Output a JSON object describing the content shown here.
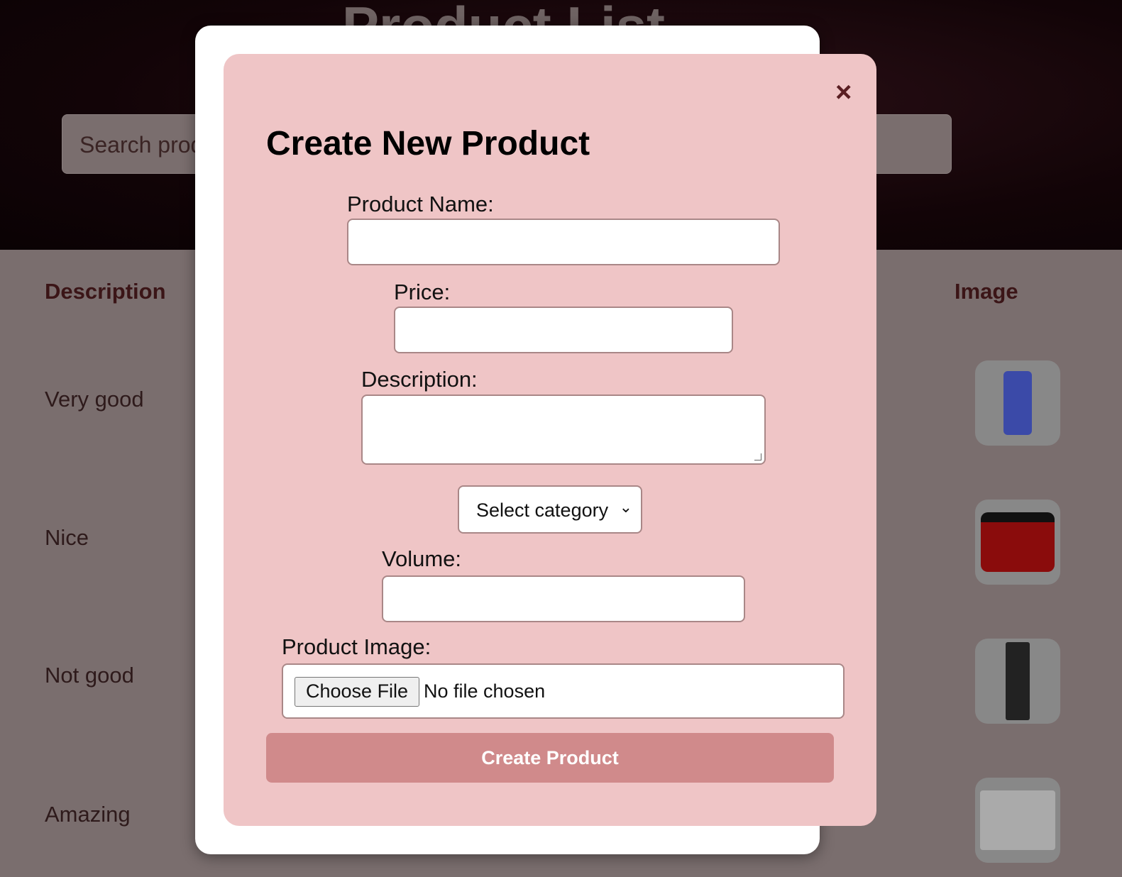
{
  "page": {
    "title": "Product List",
    "search_placeholder": "Search products..."
  },
  "table": {
    "headers": {
      "description": "Description",
      "image": "Image"
    },
    "rows": [
      {
        "description": "Very good",
        "image": "blue-bottle"
      },
      {
        "description": "Nice",
        "image": "red-jar"
      },
      {
        "description": "Not good",
        "image": "black-tube"
      },
      {
        "description": "Amazing",
        "image": "venn-jar"
      }
    ],
    "overflow_text": "..."
  },
  "modal": {
    "title": "Create New Product",
    "close_icon": "×",
    "fields": {
      "name_label": "Product Name:",
      "name_value": "",
      "price_label": "Price:",
      "price_value": "",
      "description_label": "Description:",
      "description_value": "",
      "category_value": "Select category",
      "volume_label": "Volume:",
      "volume_value": "",
      "image_label": "Product Image:",
      "file_button": "Choose File",
      "file_status": "No file chosen"
    },
    "submit_label": "Create Product"
  },
  "colors": {
    "modal_bg": "#efc5c6",
    "submit_bg": "#d08a8b",
    "heading": "#3b1517"
  }
}
